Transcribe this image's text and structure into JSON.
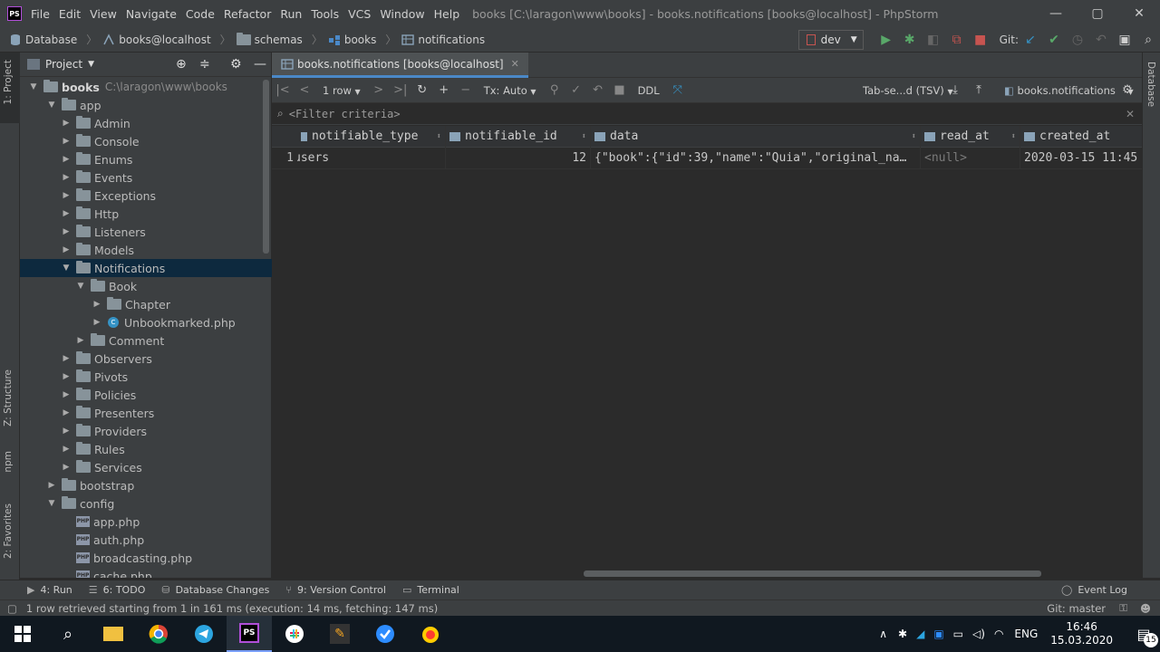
{
  "window": {
    "app_logo": "PS",
    "menu": [
      "File",
      "Edit",
      "View",
      "Navigate",
      "Code",
      "Refactor",
      "Run",
      "Tools",
      "VCS",
      "Window",
      "Help"
    ],
    "title": "books [C:\\laragon\\www\\books] - books.notifications [books@localhost] - PhpStorm",
    "controls": {
      "minimize": "—",
      "maximize": "▢",
      "close": "✕"
    }
  },
  "navbar": {
    "breadcrumbs": [
      "Database",
      "books@localhost",
      "schemas",
      "books",
      "notifications"
    ],
    "run_config": "dev",
    "git_label": "Git:"
  },
  "left_strip": {
    "project": "1: Project",
    "structure": "Z: Structure",
    "npm": "npm",
    "favorites": "2: Favorites"
  },
  "right_strip": {
    "database": "Database"
  },
  "project_panel": {
    "title": "Project",
    "tree": [
      {
        "label": "books",
        "extra": "C:\\laragon\\www\\books",
        "kind": "folder",
        "expanded": true,
        "bold": true
      },
      {
        "label": "app",
        "kind": "folder",
        "expanded": true
      },
      {
        "label": "Admin",
        "kind": "folder"
      },
      {
        "label": "Console",
        "kind": "folder"
      },
      {
        "label": "Enums",
        "kind": "folder"
      },
      {
        "label": "Events",
        "kind": "folder"
      },
      {
        "label": "Exceptions",
        "kind": "folder"
      },
      {
        "label": "Http",
        "kind": "folder"
      },
      {
        "label": "Listeners",
        "kind": "folder"
      },
      {
        "label": "Models",
        "kind": "folder"
      },
      {
        "label": "Notifications",
        "kind": "folder",
        "expanded": true,
        "selected": true
      },
      {
        "label": "Book",
        "kind": "folder",
        "expanded": true
      },
      {
        "label": "Chapter",
        "kind": "folder"
      },
      {
        "label": "Unbookmarked.php",
        "kind": "class"
      },
      {
        "label": "Comment",
        "kind": "folder"
      },
      {
        "label": "Observers",
        "kind": "folder"
      },
      {
        "label": "Pivots",
        "kind": "folder"
      },
      {
        "label": "Policies",
        "kind": "folder"
      },
      {
        "label": "Presenters",
        "kind": "folder"
      },
      {
        "label": "Providers",
        "kind": "folder"
      },
      {
        "label": "Rules",
        "kind": "folder"
      },
      {
        "label": "Services",
        "kind": "folder"
      },
      {
        "label": "bootstrap",
        "kind": "folder"
      },
      {
        "label": "config",
        "kind": "folder",
        "expanded": true
      },
      {
        "label": "app.php",
        "kind": "php"
      },
      {
        "label": "auth.php",
        "kind": "php"
      },
      {
        "label": "broadcasting.php",
        "kind": "php"
      },
      {
        "label": "cache.php",
        "kind": "php"
      }
    ]
  },
  "editor": {
    "tab_title": "books.notifications [books@localhost]",
    "toolbar": {
      "rows": "1 row",
      "tx": "Tx: Auto",
      "ddl": "DDL",
      "format": "Tab-se...d (TSV)",
      "target": "books.notifications"
    },
    "filter_placeholder": "<Filter criteria>",
    "columns": [
      "notifiable_type",
      "notifiable_id",
      "data",
      "read_at",
      "created_at"
    ],
    "rows": [
      {
        "num": "1",
        "notifiable_type": "users",
        "notifiable_id": "12",
        "data": "{\"book\":{\"id\":39,\"name\":\"Quia\",\"original_na…",
        "read_at": "<null>",
        "created_at": "2020-03-15 11:45"
      }
    ]
  },
  "bottom_tools": [
    {
      "icon": "▶",
      "label": "4: Run"
    },
    {
      "icon": "☰",
      "label": "6: TODO"
    },
    {
      "icon": "⛁",
      "label": "Database Changes"
    },
    {
      "icon": "⑂",
      "label": "9: Version Control"
    },
    {
      "icon": "▭",
      "label": "Terminal"
    }
  ],
  "event_log": "Event Log",
  "status": {
    "message": "1 row retrieved starting from 1 in 161 ms (execution: 14 ms, fetching: 147 ms)",
    "git_branch": "Git: master"
  },
  "taskbar": {
    "lang": "ENG",
    "time": "16:46",
    "date": "15.03.2020",
    "notifications": "15"
  },
  "colors": {
    "accent": "#4a88c7",
    "selection": "#0d293e",
    "bg": "#2b2b2b",
    "panel": "#3c3f41"
  }
}
